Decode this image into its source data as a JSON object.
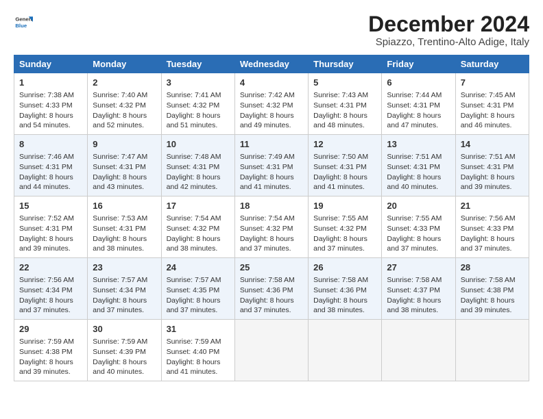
{
  "logo": {
    "line1": "General",
    "line2": "Blue"
  },
  "title": "December 2024",
  "subtitle": "Spiazzo, Trentino-Alto Adige, Italy",
  "header": {
    "accent_color": "#2a6db5"
  },
  "days_of_week": [
    "Sunday",
    "Monday",
    "Tuesday",
    "Wednesday",
    "Thursday",
    "Friday",
    "Saturday"
  ],
  "weeks": [
    [
      {
        "day": "1",
        "info": "Sunrise: 7:38 AM\nSunset: 4:33 PM\nDaylight: 8 hours and 54 minutes."
      },
      {
        "day": "2",
        "info": "Sunrise: 7:40 AM\nSunset: 4:32 PM\nDaylight: 8 hours and 52 minutes."
      },
      {
        "day": "3",
        "info": "Sunrise: 7:41 AM\nSunset: 4:32 PM\nDaylight: 8 hours and 51 minutes."
      },
      {
        "day": "4",
        "info": "Sunrise: 7:42 AM\nSunset: 4:32 PM\nDaylight: 8 hours and 49 minutes."
      },
      {
        "day": "5",
        "info": "Sunrise: 7:43 AM\nSunset: 4:31 PM\nDaylight: 8 hours and 48 minutes."
      },
      {
        "day": "6",
        "info": "Sunrise: 7:44 AM\nSunset: 4:31 PM\nDaylight: 8 hours and 47 minutes."
      },
      {
        "day": "7",
        "info": "Sunrise: 7:45 AM\nSunset: 4:31 PM\nDaylight: 8 hours and 46 minutes."
      }
    ],
    [
      {
        "day": "8",
        "info": "Sunrise: 7:46 AM\nSunset: 4:31 PM\nDaylight: 8 hours and 44 minutes."
      },
      {
        "day": "9",
        "info": "Sunrise: 7:47 AM\nSunset: 4:31 PM\nDaylight: 8 hours and 43 minutes."
      },
      {
        "day": "10",
        "info": "Sunrise: 7:48 AM\nSunset: 4:31 PM\nDaylight: 8 hours and 42 minutes."
      },
      {
        "day": "11",
        "info": "Sunrise: 7:49 AM\nSunset: 4:31 PM\nDaylight: 8 hours and 41 minutes."
      },
      {
        "day": "12",
        "info": "Sunrise: 7:50 AM\nSunset: 4:31 PM\nDaylight: 8 hours and 41 minutes."
      },
      {
        "day": "13",
        "info": "Sunrise: 7:51 AM\nSunset: 4:31 PM\nDaylight: 8 hours and 40 minutes."
      },
      {
        "day": "14",
        "info": "Sunrise: 7:51 AM\nSunset: 4:31 PM\nDaylight: 8 hours and 39 minutes."
      }
    ],
    [
      {
        "day": "15",
        "info": "Sunrise: 7:52 AM\nSunset: 4:31 PM\nDaylight: 8 hours and 39 minutes."
      },
      {
        "day": "16",
        "info": "Sunrise: 7:53 AM\nSunset: 4:31 PM\nDaylight: 8 hours and 38 minutes."
      },
      {
        "day": "17",
        "info": "Sunrise: 7:54 AM\nSunset: 4:32 PM\nDaylight: 8 hours and 38 minutes."
      },
      {
        "day": "18",
        "info": "Sunrise: 7:54 AM\nSunset: 4:32 PM\nDaylight: 8 hours and 37 minutes."
      },
      {
        "day": "19",
        "info": "Sunrise: 7:55 AM\nSunset: 4:32 PM\nDaylight: 8 hours and 37 minutes."
      },
      {
        "day": "20",
        "info": "Sunrise: 7:55 AM\nSunset: 4:33 PM\nDaylight: 8 hours and 37 minutes."
      },
      {
        "day": "21",
        "info": "Sunrise: 7:56 AM\nSunset: 4:33 PM\nDaylight: 8 hours and 37 minutes."
      }
    ],
    [
      {
        "day": "22",
        "info": "Sunrise: 7:56 AM\nSunset: 4:34 PM\nDaylight: 8 hours and 37 minutes."
      },
      {
        "day": "23",
        "info": "Sunrise: 7:57 AM\nSunset: 4:34 PM\nDaylight: 8 hours and 37 minutes."
      },
      {
        "day": "24",
        "info": "Sunrise: 7:57 AM\nSunset: 4:35 PM\nDaylight: 8 hours and 37 minutes."
      },
      {
        "day": "25",
        "info": "Sunrise: 7:58 AM\nSunset: 4:36 PM\nDaylight: 8 hours and 37 minutes."
      },
      {
        "day": "26",
        "info": "Sunrise: 7:58 AM\nSunset: 4:36 PM\nDaylight: 8 hours and 38 minutes."
      },
      {
        "day": "27",
        "info": "Sunrise: 7:58 AM\nSunset: 4:37 PM\nDaylight: 8 hours and 38 minutes."
      },
      {
        "day": "28",
        "info": "Sunrise: 7:58 AM\nSunset: 4:38 PM\nDaylight: 8 hours and 39 minutes."
      }
    ],
    [
      {
        "day": "29",
        "info": "Sunrise: 7:59 AM\nSunset: 4:38 PM\nDaylight: 8 hours and 39 minutes."
      },
      {
        "day": "30",
        "info": "Sunrise: 7:59 AM\nSunset: 4:39 PM\nDaylight: 8 hours and 40 minutes."
      },
      {
        "day": "31",
        "info": "Sunrise: 7:59 AM\nSunset: 4:40 PM\nDaylight: 8 hours and 41 minutes."
      },
      null,
      null,
      null,
      null
    ]
  ]
}
